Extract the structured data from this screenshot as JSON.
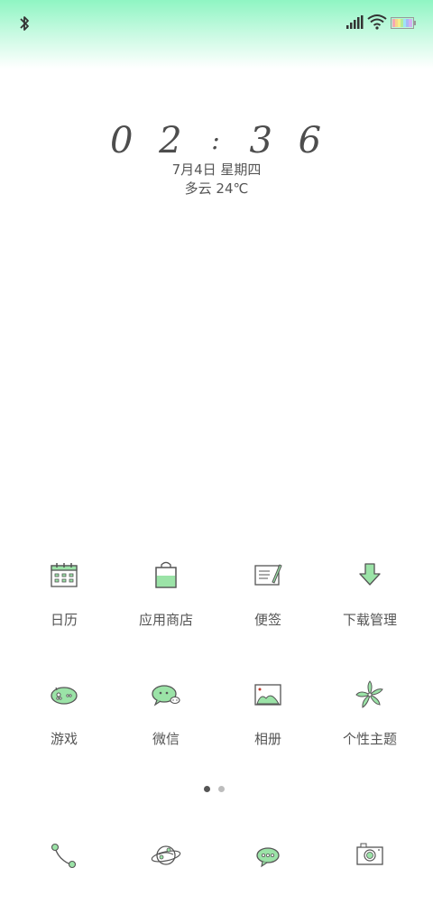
{
  "status_bar": {
    "icons": [
      "bluetooth-icon",
      "signal-icon",
      "wifi-icon",
      "battery-icon"
    ]
  },
  "clock": {
    "h1": "0",
    "h2": "2",
    "sep": ":",
    "m1": "3",
    "m2": "6",
    "date": "7月4日 星期四",
    "weather": "多云 24℃"
  },
  "apps": [
    {
      "label": "日历",
      "icon": "calendar-icon"
    },
    {
      "label": "应用商店",
      "icon": "shopping-bag-icon"
    },
    {
      "label": "便签",
      "icon": "notepad-icon"
    },
    {
      "label": "下载管理",
      "icon": "download-arrow-icon"
    },
    {
      "label": "游戏",
      "icon": "gamepad-icon"
    },
    {
      "label": "微信",
      "icon": "wechat-icon"
    },
    {
      "label": "相册",
      "icon": "photo-icon"
    },
    {
      "label": "个性主题",
      "icon": "pinwheel-icon"
    }
  ],
  "pager": {
    "pages": 2,
    "current": 1
  },
  "dock": [
    {
      "icon": "phone-icon"
    },
    {
      "icon": "browser-planet-icon"
    },
    {
      "icon": "messages-icon"
    },
    {
      "icon": "camera-icon"
    }
  ],
  "colors": {
    "accent_green": "#9be3a7",
    "stroke": "#555555",
    "status_gradient_top": "#8ff5c3"
  }
}
